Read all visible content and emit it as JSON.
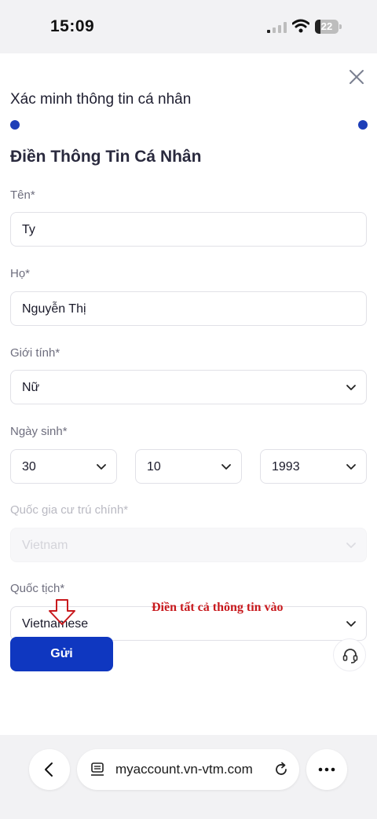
{
  "status_bar": {
    "time": "15:09",
    "battery_level": "22",
    "battery_fraction": 0.22
  },
  "form": {
    "title": "Xác minh thông tin cá nhân",
    "progress": 1.0,
    "heading": "Điền Thông Tin Cá Nhân",
    "first_name": {
      "label": "Tên*",
      "value": "Ty"
    },
    "last_name": {
      "label": "Họ*",
      "value": "Nguyễn Thị"
    },
    "gender": {
      "label": "Giới tính*",
      "value": "Nữ"
    },
    "birthdate": {
      "label": "Ngày sinh*",
      "day": "30",
      "month": "10",
      "year": "1993"
    },
    "residence": {
      "label": "Quốc gia cư trú chính*",
      "value": "Vietnam"
    },
    "nationality": {
      "label": "Quốc tịch*",
      "value": "Vietnamese"
    },
    "submit_label": "Gửi"
  },
  "annotation": {
    "text": "Điền tất cả thông tin vào",
    "color": "#c8191d"
  },
  "browser": {
    "url": "myaccount.vn-vtm.com"
  },
  "colors": {
    "accent": "#0f37c0",
    "progress": "#1d3eb8"
  },
  "icons": [
    "signal-icon",
    "wifi-icon",
    "battery-icon",
    "close-icon",
    "chevron-down-icon",
    "arrow-down-icon",
    "headset-icon",
    "back-icon",
    "page-icon",
    "reload-icon",
    "more-icon"
  ]
}
